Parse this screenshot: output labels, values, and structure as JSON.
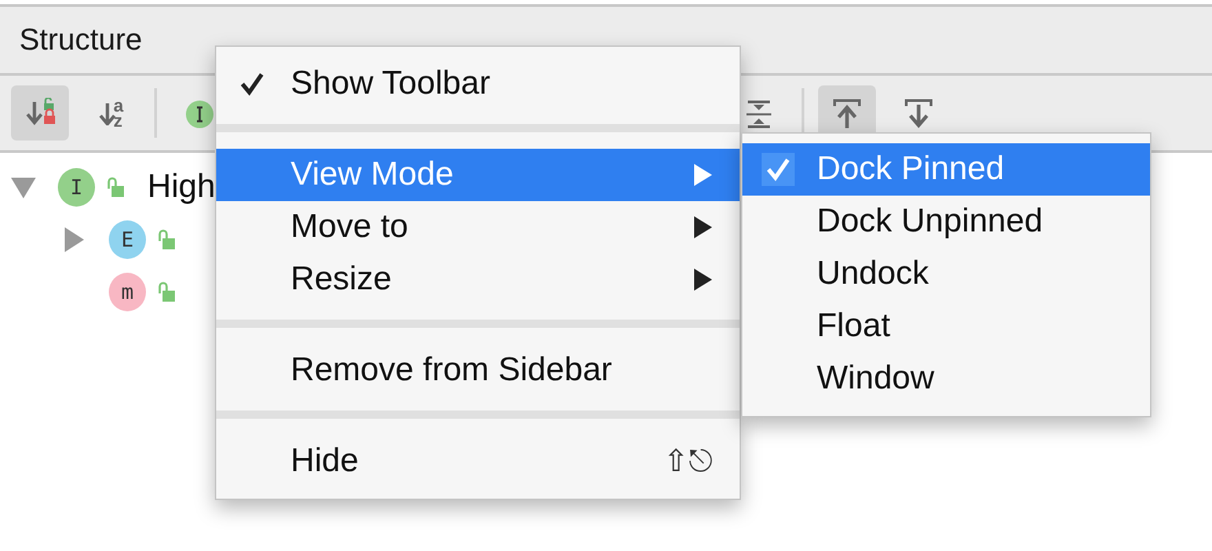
{
  "panel": {
    "title": "Structure"
  },
  "toolbar": [
    {
      "kind": "sort-visibility",
      "selected": true
    },
    {
      "kind": "sort-alpha",
      "selected": false,
      "letters": [
        "a",
        "z"
      ]
    },
    {
      "kind": "inherited",
      "selected": false
    },
    {
      "kind": "collapse",
      "selected": false
    },
    {
      "kind": "separator"
    },
    {
      "kind": "scroll-from",
      "selected": true
    },
    {
      "kind": "scroll-to",
      "selected": false
    }
  ],
  "tree": [
    {
      "badge": "I",
      "color": "#93d08a",
      "label": "High",
      "expanded": true,
      "children": [
        {
          "badge": "E",
          "color": "#8fd3ef",
          "expanded": false
        },
        {
          "badge": "m",
          "color": "#f8b7c3"
        }
      ]
    }
  ],
  "menu": [
    {
      "kind": "item",
      "label": "Show Toolbar",
      "checked": true,
      "selected": false,
      "submenu": false
    },
    {
      "kind": "separator"
    },
    {
      "kind": "item",
      "label": "View Mode",
      "checked": false,
      "selected": true,
      "submenu": true
    },
    {
      "kind": "item",
      "label": "Move to",
      "checked": false,
      "selected": false,
      "submenu": true
    },
    {
      "kind": "item",
      "label": "Resize",
      "checked": false,
      "selected": false,
      "submenu": true
    },
    {
      "kind": "separator"
    },
    {
      "kind": "item",
      "label": "Remove from Sidebar",
      "checked": false,
      "selected": false,
      "submenu": false
    },
    {
      "kind": "separator"
    },
    {
      "kind": "item",
      "label": "Hide",
      "checked": false,
      "selected": false,
      "submenu": false,
      "shortcut": "⇧⎋"
    }
  ],
  "submenu": [
    {
      "label": "Dock Pinned",
      "checked": true,
      "selected": true
    },
    {
      "label": "Dock Unpinned",
      "checked": false,
      "selected": false
    },
    {
      "label": "Undock",
      "checked": false,
      "selected": false
    },
    {
      "label": "Float",
      "checked": false,
      "selected": false
    },
    {
      "label": "Window",
      "checked": false,
      "selected": false
    }
  ]
}
